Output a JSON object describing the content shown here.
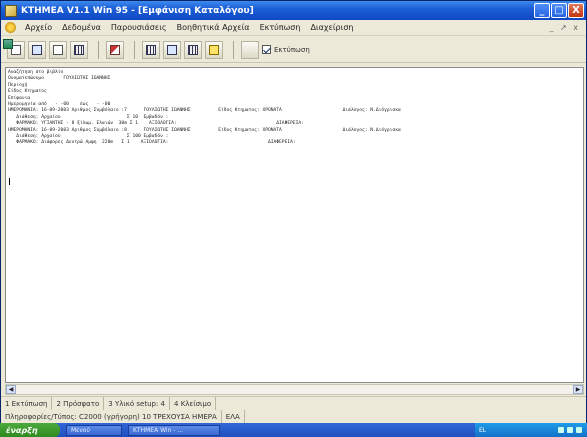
{
  "window": {
    "title": "ΚΤΗΜΕΑ   V1.1 Win 95 - [Εμφάνιση Καταλόγου]",
    "controls": {
      "minimize": "_",
      "maximize": "□",
      "close": "X"
    }
  },
  "menubar": {
    "items": [
      "Αρχείο",
      "Δεδομένα",
      "Παρουσιάσεις",
      "Βοηθητικά Αρχεία",
      "Εκτύπωση",
      "Διαχείριση"
    ],
    "right_controls": "_ ↗ x"
  },
  "toolbar": {
    "checkbox_label": "Εκτύπωση",
    "checkbox_checked": true,
    "icons": [
      "doc-icon",
      "doc-icon",
      "doc-icon",
      "grid-icon",
      "pen-icon",
      "table-icon",
      "table-icon",
      "table-icon",
      "help-icon",
      "report-icon"
    ]
  },
  "report": {
    "lines": [
      "Αναζήτηση στο βιβλίο",
      "Ονοματεπώνυμο       ΓΟΥΛΙΩΤΗΣ ΙΩΑΝΝΗΣ",
      "Περιοχή",
      "Είδος Κτηματος",
      "Επίφανια",
      "Ημερομηνία από   - -00    έως   - -00",
      "ΗΜΕΡΟΜΗΝΙΑ: 16-09-2003 Αριθμος Συμβόλαιο :7      ΓΟΥΛΙΩΤΗΣ ΙΩΑΝΝΗΣ          Είδος Κτηματος: ΧΡΟΝΑΤΑ                      Διάλογος: Ν.Διόγρισκα",
      "   Διάθεση: Αρχαίου                        Σ 10  Εμβαδόν :",
      "   ΦΑΡΜΑΚΟ: ΥΓΙΑΝΤΗΣ - 8 ξίλωμ. Ελαιών  30m Σ 1    ΑΞΙΟΛΟΓΙΑ:                                    ΔΙΑΦΕΡΕΙΑ:",
      "ΗΜΕΡΟΜΗΝΙΑ: 16-09-2003 Αριθμος Συμβόλαιο :8      ΓΟΥΛΙΩΤΗΣ ΙΩΑΝΝΗΣ          Είδος Κτηματος: ΧΡΟΝΑΤΑ                      Διάλογος: Ν.Διόγρισκα",
      "   Διάθεση: Αρχαίου                        Σ 100 Εμβαδόν :",
      "   ΦΑΡΜΑΚΟ: Διάφορες Δεντρώ Αμφη  220m   Σ 1    ΑΞΙΟΛΟΓΙΑ:                                    ΔΙΑΦΕΡΕΙΑ:"
    ]
  },
  "status": {
    "row1": [
      "1 Εκτύπωση",
      "2 Πρόσφατο",
      "3 Υλικό setup: 4",
      "4 Κλείσιμο"
    ],
    "row2": [
      "Πληροφορίες/Τύπος: C2000 (γρήγορη) 10 ΤΡΕΧΟΥΣΑ ΗΜΕΡΑ",
      "ΕΛΑ"
    ]
  },
  "taskbar": {
    "start_label": "έναρξη",
    "tasks": [
      "Μενού",
      "ΚΤΗΜΕΑ  Win - ..."
    ],
    "lang": "EL"
  }
}
